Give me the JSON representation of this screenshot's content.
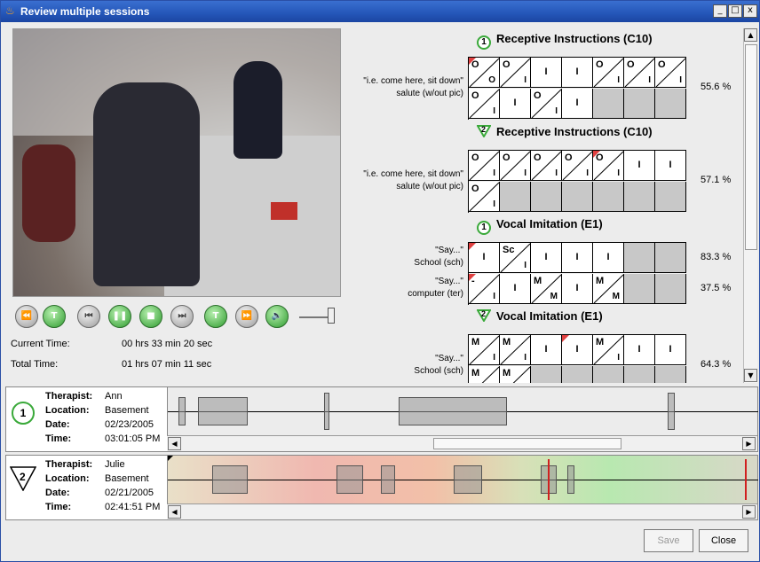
{
  "window": {
    "title": "Review multiple sessions",
    "app_icon": "java-cup-icon",
    "buttons": {
      "minimize": "_",
      "maximize": "□",
      "close": "x"
    }
  },
  "player": {
    "controls": [
      {
        "name": "rewind-fast-button",
        "glyph": "⏪",
        "green": false
      },
      {
        "name": "next-trial-button",
        "glyph": "T",
        "green": true
      },
      {
        "name": "skip-back-button",
        "glyph": "⏮",
        "green": false
      },
      {
        "name": "pause-button",
        "glyph": "❚❚",
        "green": true
      },
      {
        "name": "stop-button",
        "glyph": "■",
        "green": true
      },
      {
        "name": "skip-forward-button",
        "glyph": "⏭",
        "green": false
      },
      {
        "name": "prev-trial-button",
        "glyph": "T",
        "green": true
      },
      {
        "name": "fast-forward-button",
        "glyph": "⏩",
        "green": false
      },
      {
        "name": "volume-button",
        "glyph": "🔈",
        "green": true
      }
    ],
    "current_time_label": "Current Time:",
    "current_time": "00 hrs 33 min 20 sec",
    "total_time_label": "Total Time:",
    "total_time": "01 hrs 07 min 11 sec"
  },
  "sections": [
    {
      "badge": "1",
      "badge_type": "circle",
      "title": "Receptive Instructions (C10)",
      "rows": [
        {
          "label1": "\"i.e. come here, sit down\"",
          "label2": "salute (w/out pic)",
          "pct": "55.6 %"
        }
      ],
      "cells": [
        [
          {
            "tl": "O",
            "br": "O",
            "flag": true
          },
          {
            "tl": "O",
            "br": "I"
          },
          {
            "mid": "I"
          },
          {
            "mid": "I"
          },
          {
            "tl": "O",
            "br": "I"
          },
          {
            "tl": "O",
            "br": "I"
          },
          {
            "tl": "O",
            "br": "I"
          }
        ],
        [
          {
            "tl": "O",
            "br": "I"
          },
          {
            "mid": "I"
          },
          {
            "tl": "O",
            "br": "I"
          },
          {
            "mid": "I"
          },
          {
            "empty": true
          },
          {
            "empty": true
          },
          {
            "empty": true
          }
        ]
      ]
    },
    {
      "badge": "2",
      "badge_type": "triangle",
      "title": "Receptive Instructions (C10)",
      "rows": [
        {
          "label1": "\"i.e. come here, sit down\"",
          "label2": "salute (w/out pic)",
          "pct": "57.1 %"
        }
      ],
      "cells": [
        [
          {
            "tl": "O",
            "br": "I"
          },
          {
            "tl": "O",
            "br": "I"
          },
          {
            "tl": "O",
            "br": "I"
          },
          {
            "tl": "O",
            "br": "I"
          },
          {
            "tl": "O",
            "br": "I",
            "flag": true
          },
          {
            "mid": "I"
          },
          {
            "mid": "I"
          }
        ],
        [
          {
            "tl": "O",
            "br": "I"
          },
          {
            "empty": true
          },
          {
            "empty": true
          },
          {
            "empty": true
          },
          {
            "empty": true
          },
          {
            "empty": true
          },
          {
            "empty": true
          }
        ]
      ]
    },
    {
      "badge": "1",
      "badge_type": "circle",
      "title": "Vocal Imitation (E1)",
      "rows": [
        {
          "label1": "\"Say...\"",
          "label2": "School (sch)",
          "pct": "83.3 %"
        },
        {
          "label1": "\"Say...\"",
          "label2": "computer (ter)",
          "pct": "37.5 %"
        }
      ],
      "cells": [
        [
          {
            "mid": "I",
            "flag": true
          },
          {
            "tl": "Sc",
            "br": "I"
          },
          {
            "mid": "I"
          },
          {
            "mid": "I"
          },
          {
            "mid": "I"
          },
          {
            "empty": true
          },
          {
            "empty": true
          }
        ],
        [
          {
            "tl": "-",
            "br": "I",
            "flag": true
          },
          {
            "mid": "I"
          },
          {
            "tl": "M",
            "br": "M"
          },
          {
            "mid": "I"
          },
          {
            "tl": "M",
            "br": "M"
          },
          {
            "empty": true
          },
          {
            "empty": true
          }
        ]
      ]
    },
    {
      "badge": "2",
      "badge_type": "triangle",
      "title": "Vocal Imitation (E1)",
      "rows": [
        {
          "label1": "\"Say...\"",
          "label2": "School (sch)",
          "pct": "64.3 %"
        }
      ],
      "cells": [
        [
          {
            "tl": "M",
            "br": "I"
          },
          {
            "tl": "M",
            "br": "I"
          },
          {
            "mid": "I"
          },
          {
            "mid": "I",
            "flag": true
          },
          {
            "tl": "M",
            "br": "I"
          },
          {
            "mid": "I"
          },
          {
            "mid": "I"
          }
        ],
        [
          {
            "tl": "M",
            "br": "M"
          },
          {
            "tl": "M",
            "br": ""
          },
          {
            "empty": true
          },
          {
            "empty": true
          },
          {
            "empty": true
          },
          {
            "empty": true
          },
          {
            "empty": true
          }
        ]
      ]
    }
  ],
  "sessions": [
    {
      "badge": "1",
      "badge_type": "circle",
      "therapist_label": "Therapist:",
      "therapist": "Ann",
      "location_label": "Location:",
      "location": "Basement",
      "date_label": "Date:",
      "date": "02/23/2005",
      "time_label": "Time:",
      "time": "03:01:05 PM",
      "gradient": false
    },
    {
      "badge": "2",
      "badge_type": "triangle",
      "therapist_label": "Therapist:",
      "therapist": "Julie",
      "location_label": "Location:",
      "location": "Basement",
      "date_label": "Date:",
      "date": "02/21/2005",
      "time_label": "Time:",
      "time": "02:41:51 PM",
      "gradient": true
    }
  ],
  "buttons": {
    "save": "Save",
    "close": "Close"
  }
}
